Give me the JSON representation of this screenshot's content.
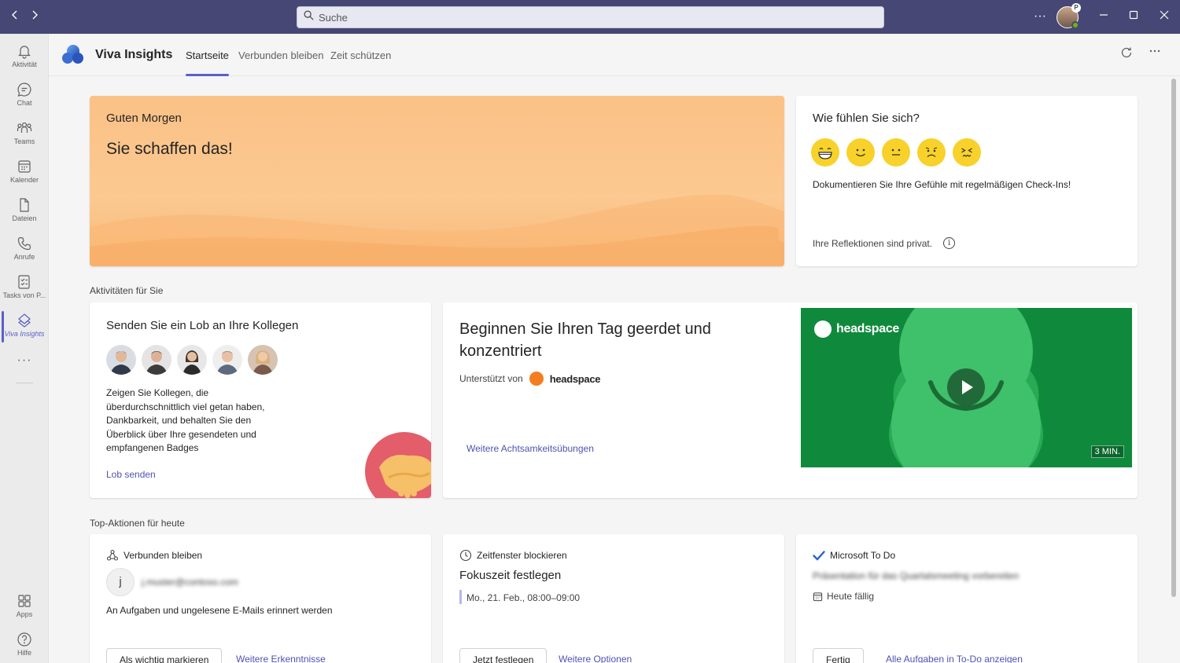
{
  "titlebar": {
    "back_icon": "chevron-left-icon",
    "forward_icon": "chevron-right-icon",
    "search_placeholder": "Suche",
    "more_label": "···",
    "avatar_badge": "P"
  },
  "rail": {
    "items": [
      {
        "label": "Aktivität",
        "icon": "bell-icon"
      },
      {
        "label": "Chat",
        "icon": "chat-icon"
      },
      {
        "label": "Teams",
        "icon": "teams-icon"
      },
      {
        "label": "Kalender",
        "icon": "calendar-icon"
      },
      {
        "label": "Dateien",
        "icon": "file-icon"
      },
      {
        "label": "Anrufe",
        "icon": "phone-icon"
      },
      {
        "label": "Tasks von P...",
        "icon": "tasks-icon"
      },
      {
        "label": "Viva Insights",
        "icon": "viva-icon"
      }
    ],
    "more": "···",
    "bottom": [
      {
        "label": "Apps",
        "icon": "apps-icon"
      },
      {
        "label": "Hilfe",
        "icon": "help-icon"
      }
    ]
  },
  "app": {
    "title": "Viva Insights",
    "tabs": [
      "Startseite",
      "Verbunden bleiben",
      "Zeit schützen"
    ],
    "active_tab": "Startseite"
  },
  "greeting": {
    "title": "Guten Morgen",
    "message": "Sie schaffen das!"
  },
  "mood": {
    "title": "Wie fühlen Sie sich?",
    "description": "Dokumentieren Sie Ihre Gefühle mit regelmäßigen Check-Ins!",
    "privacy": "Ihre Reflektionen sind privat.",
    "emojis": [
      "grinning-face-icon",
      "smiling-face-icon",
      "neutral-face-icon",
      "worried-face-icon",
      "stressed-face-icon"
    ]
  },
  "activities": {
    "section_label": "Aktivitäten für Sie",
    "praise": {
      "title": "Senden Sie ein Lob an Ihre Kollegen",
      "description": "Zeigen Sie Kollegen, die überdurchschnittlich viel getan haben, Dankbarkeit, und behalten Sie den Überblick über Ihre gesendeten und empfangenen Badges",
      "link": "Lob senden"
    },
    "headspace": {
      "title": "Beginnen Sie Ihren Tag geerdet und konzentriert",
      "supported_by": "Unterstützt von",
      "brand": "headspace",
      "link": "Weitere Achtsamkeitsübungen",
      "duration": "3 MIN."
    }
  },
  "top_actions": {
    "section_label": "Top-Aktionen für heute",
    "cards": [
      {
        "category": "Verbunden bleiben",
        "avatar_letter": "j",
        "email": "j.muster@contoso.com",
        "description": "An Aufgaben und ungelesene E-Mails erinnert werden",
        "button": "Als wichtig markieren",
        "link": "Weitere Erkenntnisse"
      },
      {
        "category": "Zeitfenster blockieren",
        "title": "Fokuszeit festlegen",
        "time": "Mo., 21. Feb., 08:00–09:00",
        "button": "Jetzt festlegen",
        "link": "Weitere Optionen"
      },
      {
        "category": "Microsoft To Do",
        "task": "Präsentation für das Quartalsmeeting vorbereiten",
        "due": "Heute fällig",
        "button": "Fertig",
        "link": "Alle Aufgaben in To-Do anzeigen"
      }
    ]
  },
  "colors": {
    "titlebar": "#464775",
    "accent": "#5b5fc7",
    "link": "#4f52b2",
    "greeting_bg": "#fbc186",
    "emoji": "#f8d22a",
    "headspace_green": "#0e8b3d"
  }
}
